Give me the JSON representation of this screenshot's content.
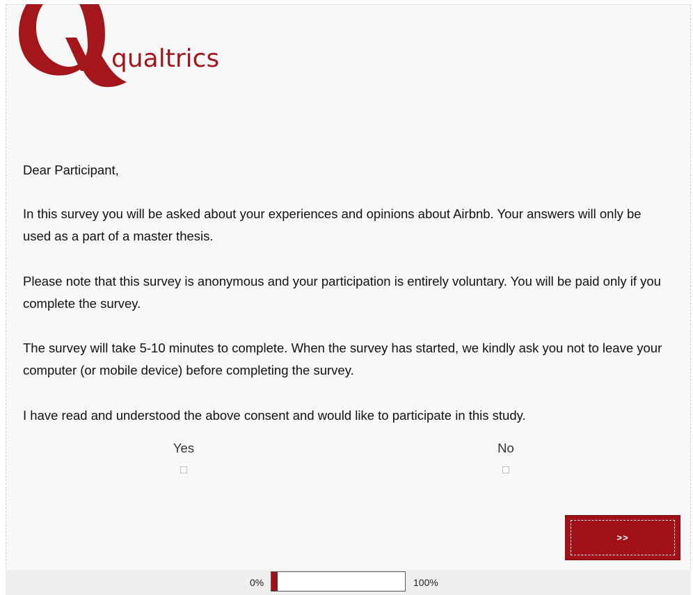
{
  "brand": {
    "name": "qualtrics",
    "accent_color": "#a01016"
  },
  "content": {
    "greeting": "Dear Participant,",
    "paragraphs": [
      "In this survey you will be asked about your experiences and opinions about Airbnb. Your answers will only be used as a part of a master thesis.",
      "Please note that this survey is anonymous and your participation is entirely voluntary. You will be paid only if you complete the survey.",
      "The survey will take 5-10 minutes to complete. When the survey has started, we kindly ask you not to leave your computer (or mobile device) before completing the survey.",
      "I have read and understood the above consent and would like to participate in this study."
    ]
  },
  "question": {
    "options": [
      {
        "label": "Yes",
        "selected": false
      },
      {
        "label": "No",
        "selected": false
      }
    ]
  },
  "navigation": {
    "next_label": ">>"
  },
  "progress": {
    "start_label": "0%",
    "end_label": "100%",
    "percent": 4
  }
}
